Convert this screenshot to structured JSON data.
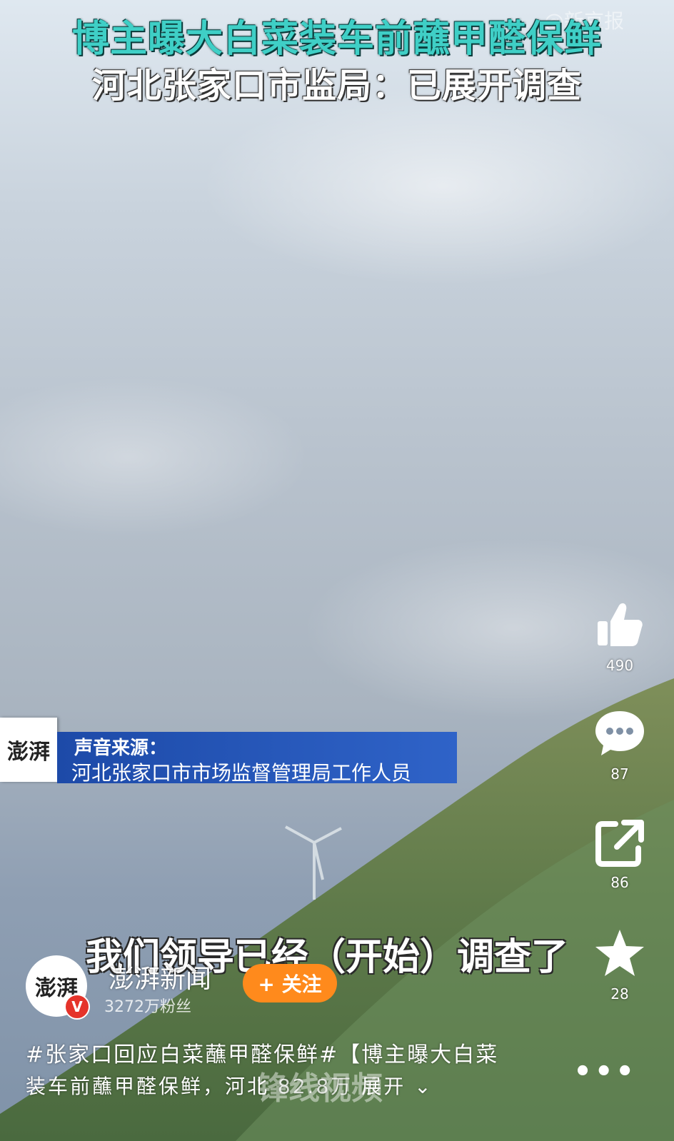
{
  "video": {
    "headline": "博主曝大白菜装车前蘸甲醛保鲜",
    "subheadline": "河北张家口市监局：已展开调查",
    "source_label": "声音来源：",
    "source_text": "河北张家口市市场监督管理局工作人员",
    "source_logo": "澎湃",
    "subtitle": "我们领导已经（开始）调查了",
    "watermark_top": "@新京报",
    "watermark_bottom": "锋线视频"
  },
  "actions": {
    "like_count": "490",
    "comment_count": "87",
    "share_count": "86",
    "favorite_count": "28"
  },
  "account": {
    "avatar_text": "澎湃",
    "verified_mark": "V",
    "name": "澎湃新闻",
    "followers": "3272万粉丝",
    "follow_label": "+ 关注"
  },
  "caption": {
    "line1": "#张家口回应白菜蘸甲醛保鲜#【博主曝大白菜",
    "line2_text": "装车前蘸甲醛保鲜，河北",
    "line2_views": "82.8万",
    "line2_expand": "展开"
  },
  "more_label": "•••",
  "colors": {
    "headline": "#3fcfc6",
    "source_bar": "#1d4aa8",
    "follow_button": "#ff8a1c",
    "verified_badge": "#e5332a"
  }
}
